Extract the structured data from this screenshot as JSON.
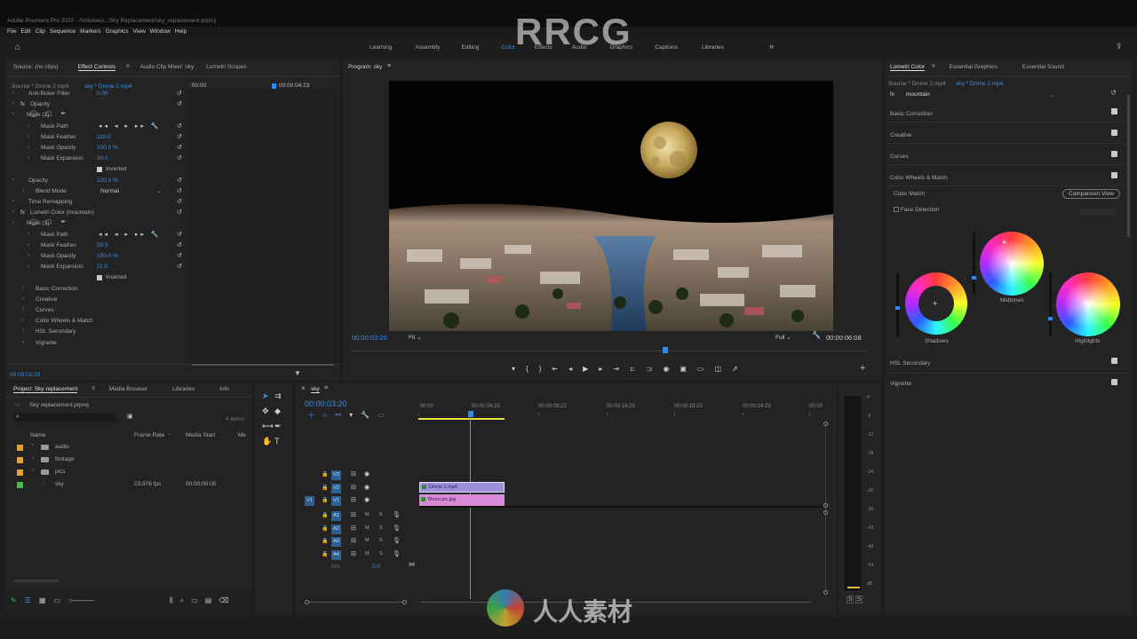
{
  "window_title": "Adobe Premiere Pro 2020 - /Volumes/...Sky Replacement/sky_replacement.prproj",
  "menu": [
    "File",
    "Edit",
    "Clip",
    "Sequence",
    "Markers",
    "Graphics",
    "View",
    "Window",
    "Help"
  ],
  "workspaces": [
    "Learning",
    "Assembly",
    "Editing",
    "Color",
    "Effects",
    "Audio",
    "Graphics",
    "Captions",
    "Libraries"
  ],
  "active_workspace": "Color",
  "effect_controls": {
    "tabs": [
      "Source: (no clips)",
      "Effect Controls",
      "Audio Clip Mixer: sky",
      "Lumetri Scopes"
    ],
    "source": "Source * Drone 2.mp4",
    "sequence": "sky * Drone 2.mp4",
    "tl_start": ":00:00",
    "tl_end": "00:00:04:23",
    "rows": [
      {
        "label": "Anti-flicker Filter",
        "value": "0.00"
      },
      {
        "label": "Opacity",
        "value": ""
      },
      {
        "label": "Mask (1)",
        "value": ""
      },
      {
        "label": "Mask Path",
        "value": ""
      },
      {
        "label": "Mask Feather",
        "value": "110.0"
      },
      {
        "label": "Mask Opacity",
        "value": "100.0 %"
      },
      {
        "label": "Mask Expansion",
        "value": "30.0"
      },
      {
        "label": "",
        "value": "Inverted"
      },
      {
        "label": "Opacity",
        "value": "100.0 %"
      },
      {
        "label": "Blend Mode",
        "value": "Normal"
      },
      {
        "label": "Time Remapping",
        "value": ""
      },
      {
        "label": "Lumetri Color (mountain)",
        "value": ""
      },
      {
        "label": "Mask (1)",
        "value": ""
      },
      {
        "label": "Mask Path",
        "value": ""
      },
      {
        "label": "Mask Feather",
        "value": "50.0"
      },
      {
        "label": "Mask Opacity",
        "value": "100.0 %"
      },
      {
        "label": "Mask Expansion",
        "value": "11.0"
      },
      {
        "label": "",
        "value": "Inverted"
      },
      {
        "label": "Basic Correction",
        "value": ""
      },
      {
        "label": "Creative",
        "value": ""
      },
      {
        "label": "Curves",
        "value": ""
      },
      {
        "label": "Color Wheels & Match",
        "value": ""
      },
      {
        "label": "HSL Secondary",
        "value": ""
      },
      {
        "label": "Vignette",
        "value": ""
      }
    ],
    "footer_time": "00:00:03:20"
  },
  "program": {
    "title": "Program: sky",
    "timecode": "00:00:03:20",
    "fit": "Fit",
    "quality": "Full",
    "duration": "00:00:06:08"
  },
  "lumetri": {
    "tabs": [
      "Lumetri Color",
      "Essential Graphics",
      "Essential Sound"
    ],
    "source": "Source * Drone 2.mp4",
    "sequence": "sky * Drone 2.mp4",
    "preset": "mountain",
    "sections": [
      "Basic Correction",
      "Creative",
      "Curves",
      "Color Wheels & Match"
    ],
    "color_match": "Color Match",
    "comparison_view": "Comparison View",
    "face_detection": "Face Detection",
    "wheels": [
      "Shadows",
      "Midtones",
      "Highlights"
    ],
    "hsl": "HSL Secondary",
    "vignette": "Vignette"
  },
  "project": {
    "tabs": [
      "Project: Sky replacement",
      "Media Browser",
      "Libraries",
      "Info"
    ],
    "file": "Sky replacement.prproj",
    "count": "4 items",
    "columns": [
      "Name",
      "Frame Rate",
      "Media Start",
      "Me"
    ],
    "items": [
      {
        "name": "audio",
        "fps": "",
        "start": "",
        "color": "#e8a02b"
      },
      {
        "name": "footage",
        "fps": "",
        "start": "",
        "color": "#e8a02b"
      },
      {
        "name": "pics",
        "fps": "",
        "start": "",
        "color": "#e8a02b"
      },
      {
        "name": "sky",
        "fps": "23.976 fps",
        "start": "00:00:00:00",
        "color": "#3fbf4f"
      }
    ]
  },
  "timeline": {
    "tab": "sky",
    "timecode": "00:00:03:20",
    "ruler": [
      ":00:00",
      "00:00:04:23",
      "00:00:09:23",
      "00:00:14:23",
      "00:00:19:23",
      "00:00:24:23",
      "00:00"
    ],
    "video_tracks": [
      "V3",
      "V2",
      "V1"
    ],
    "audio_tracks": [
      "A1",
      "A2",
      "A3",
      "A4"
    ],
    "mix": "Mix",
    "mix_value": "0.0",
    "clips": [
      {
        "name": "Drone 2.mp4",
        "color": "#9d8fd8"
      },
      {
        "name": "Moon pic.jpg",
        "color": "#d78ad6"
      }
    ]
  },
  "meter_labels": [
    "0",
    "-6",
    "-12",
    "-18",
    "-24",
    "-30",
    "-36",
    "-42",
    "-48",
    "-54",
    "dB"
  ],
  "meter_buttons": [
    "S",
    "S"
  ],
  "watermarks": [
    "RRCG",
    "人人素材"
  ]
}
